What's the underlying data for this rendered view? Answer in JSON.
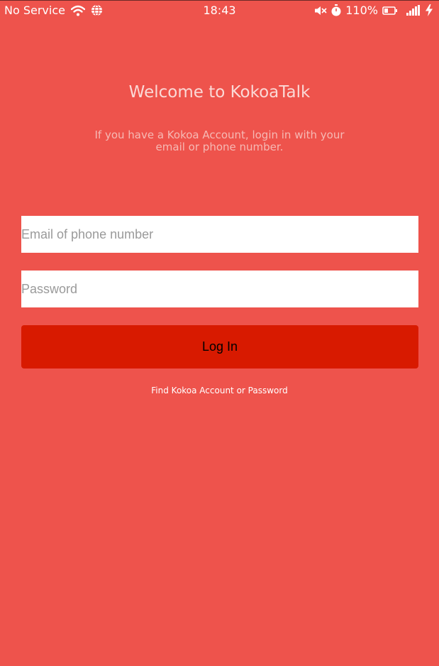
{
  "status_bar": {
    "carrier": "No Service",
    "time": "18:43",
    "battery": "110%",
    "icons": {
      "wifi": "wifi-icon",
      "globe": "globe-icon",
      "mute": "mute-icon",
      "timer": "stopwatch-icon",
      "battery": "battery-icon",
      "signal": "signal-icon",
      "charging": "charging-bolt-icon"
    }
  },
  "login": {
    "title": "Welcome to KokoaTalk",
    "subtitle": "If you have a Kokoa Account, login in with your email or phone number.",
    "email_placeholder": "Email of phone number",
    "password_placeholder": "Password",
    "login_button": "Log In",
    "find_link": "Find Kokoa Account or Password"
  },
  "colors": {
    "background": "#ee534c",
    "button": "#d81a00",
    "title_text": "#fbd9d6",
    "subtitle_text": "#f6b9b4"
  }
}
